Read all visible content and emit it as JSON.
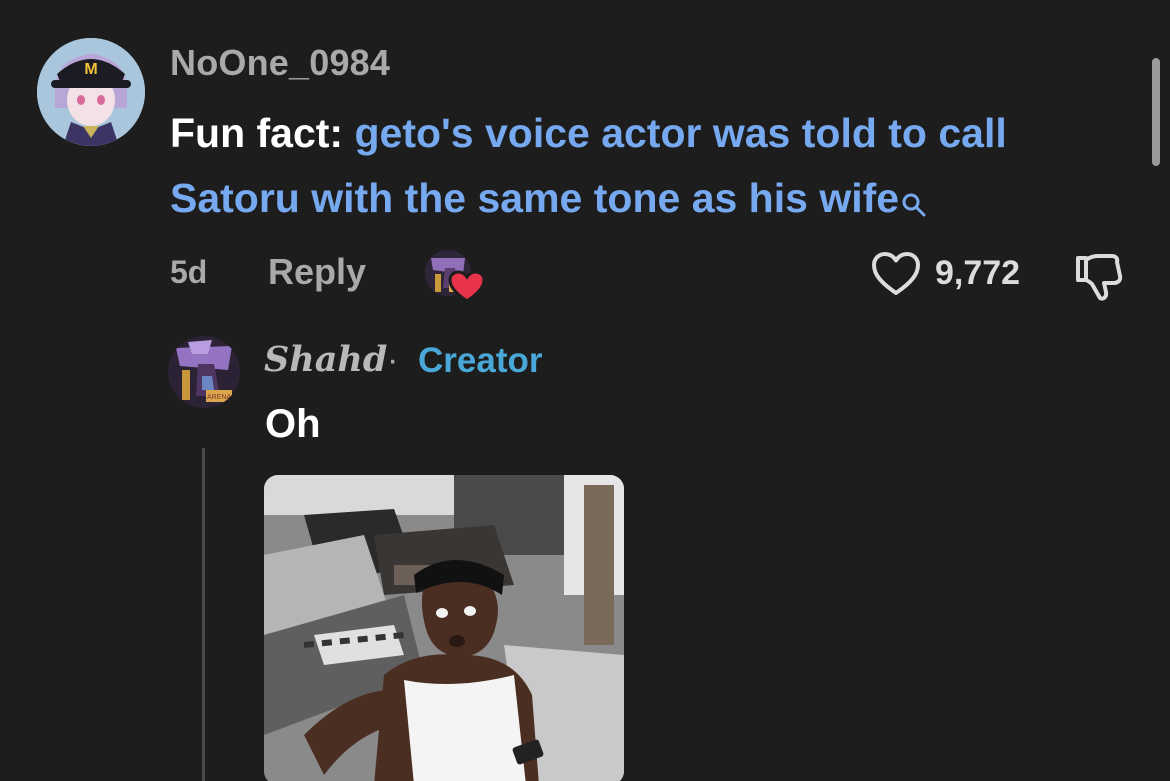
{
  "comment": {
    "username": "NoOne_0984",
    "text_prefix": "Fun fact: ",
    "text_link": "geto's voice actor was told to call Satoru with the same tone as his wife",
    "time": "5d",
    "reply_label": "Reply",
    "like_count": "9,772"
  },
  "reply": {
    "username": "Shahd",
    "separator": "·",
    "badge": "Creator",
    "text": "Oh"
  },
  "colors": {
    "background": "#1d1d1d",
    "link": "#76a9f0",
    "creator": "#4aa8d8",
    "muted": "#a9a9a9",
    "heart": "#e8334a"
  },
  "icons": [
    "search-icon",
    "heart-outline-icon",
    "thumbs-down-icon",
    "heart-badge-icon"
  ]
}
